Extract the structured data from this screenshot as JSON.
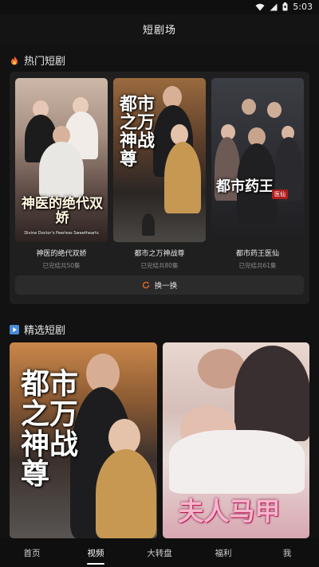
{
  "status_bar": {
    "time": "5:03",
    "icons": [
      "wifi-icon",
      "signal-icon",
      "battery-icon"
    ]
  },
  "header": {
    "title": "短剧场"
  },
  "hot_section": {
    "title": "热门短剧",
    "icon": "fire-icon",
    "items": [
      {
        "name": "神医的绝代双娇",
        "count": "已完结共50集",
        "poster_title": "神医的绝代双娇",
        "poster_subtitle": "Divine Doctor's Peerless Sweethearts"
      },
      {
        "name": "都市之万神战尊",
        "count": "已完结共80集",
        "poster_title": "都市之万神战尊"
      },
      {
        "name": "都市药王医仙",
        "count": "已完结共61集",
        "poster_title": "都市药王",
        "poster_badge": "医仙"
      }
    ],
    "refresh_label": "换一换",
    "refresh_icon": "refresh-icon"
  },
  "featured_section": {
    "title": "精选短剧",
    "icon": "play-icon",
    "items": [
      {
        "poster_title": "都市之万神战尊"
      },
      {
        "poster_title": "夫人马甲"
      }
    ]
  },
  "bottom_nav": {
    "items": [
      "首页",
      "视频",
      "大转盘",
      "福利",
      "我"
    ],
    "active_index": 1
  },
  "colors": {
    "accent_refresh": "#e8692b",
    "fire": "#ff6a2b",
    "play": "#4a8ad8"
  }
}
